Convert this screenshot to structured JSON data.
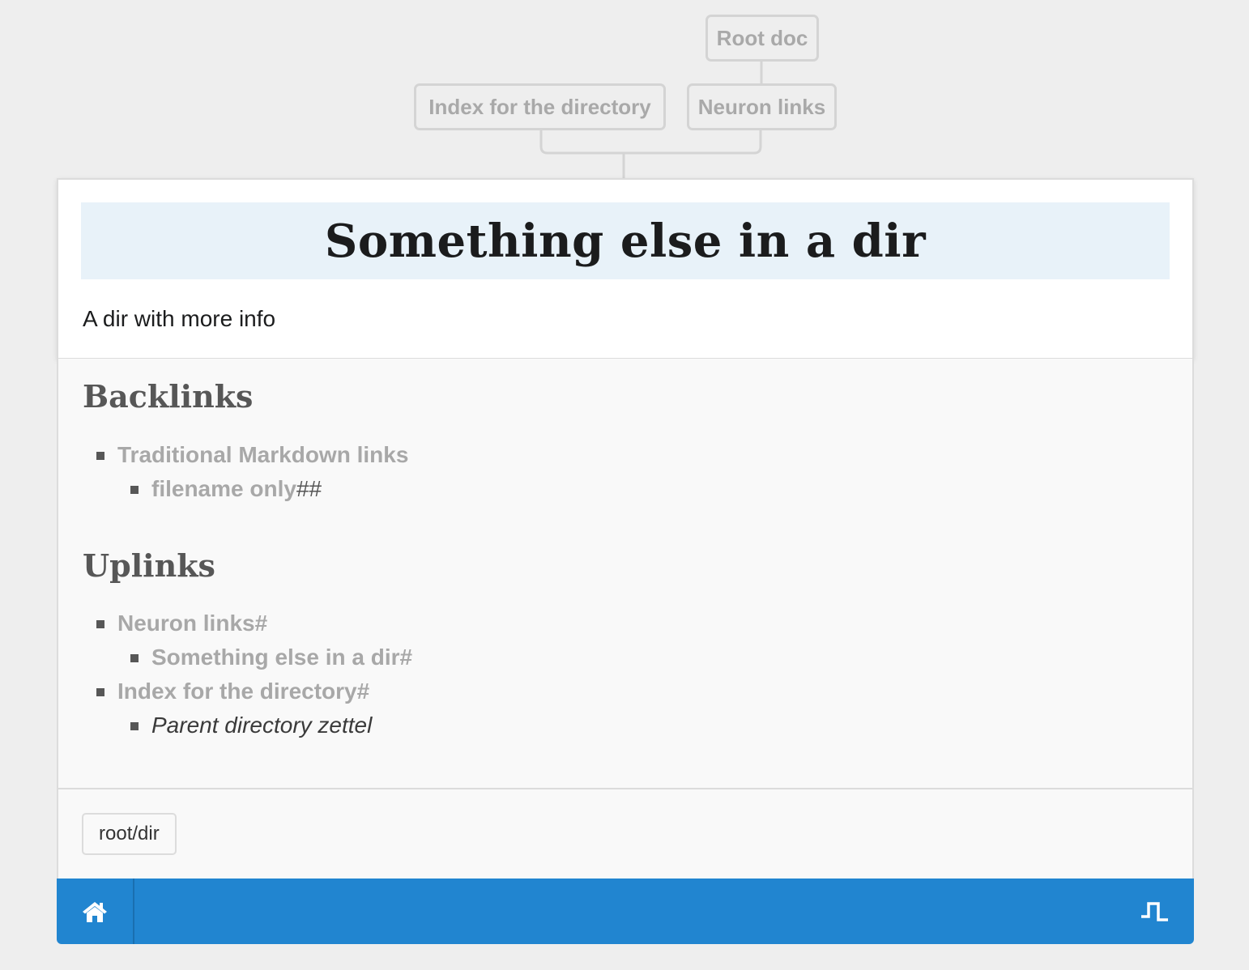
{
  "tree": {
    "root": "Root doc",
    "index": "Index for the directory",
    "neuron": "Neuron links"
  },
  "note": {
    "title": "Something else in a dir",
    "description": "A dir with more info"
  },
  "backlinks": {
    "heading": "Backlinks",
    "items": [
      {
        "label": "Traditional Markdown links"
      },
      {
        "label": "filename only",
        "hash": "##"
      }
    ]
  },
  "uplinks": {
    "heading": "Uplinks",
    "items": [
      {
        "label": "Neuron links",
        "hash": "#"
      },
      {
        "label": "Something else in a dir",
        "hash": "#"
      },
      {
        "label": "Index for the directory",
        "hash": "#"
      },
      {
        "label": "Parent directory zettel"
      }
    ]
  },
  "tags": [
    "root/dir"
  ],
  "bottombar": {
    "home_icon": "home-icon",
    "graph_icon": "pulse-graph-icon",
    "color": "#2185d0"
  },
  "colors": {
    "background": "#eeeeee",
    "title_bg": "#e8f2f9",
    "link": "#a8a8a8"
  }
}
